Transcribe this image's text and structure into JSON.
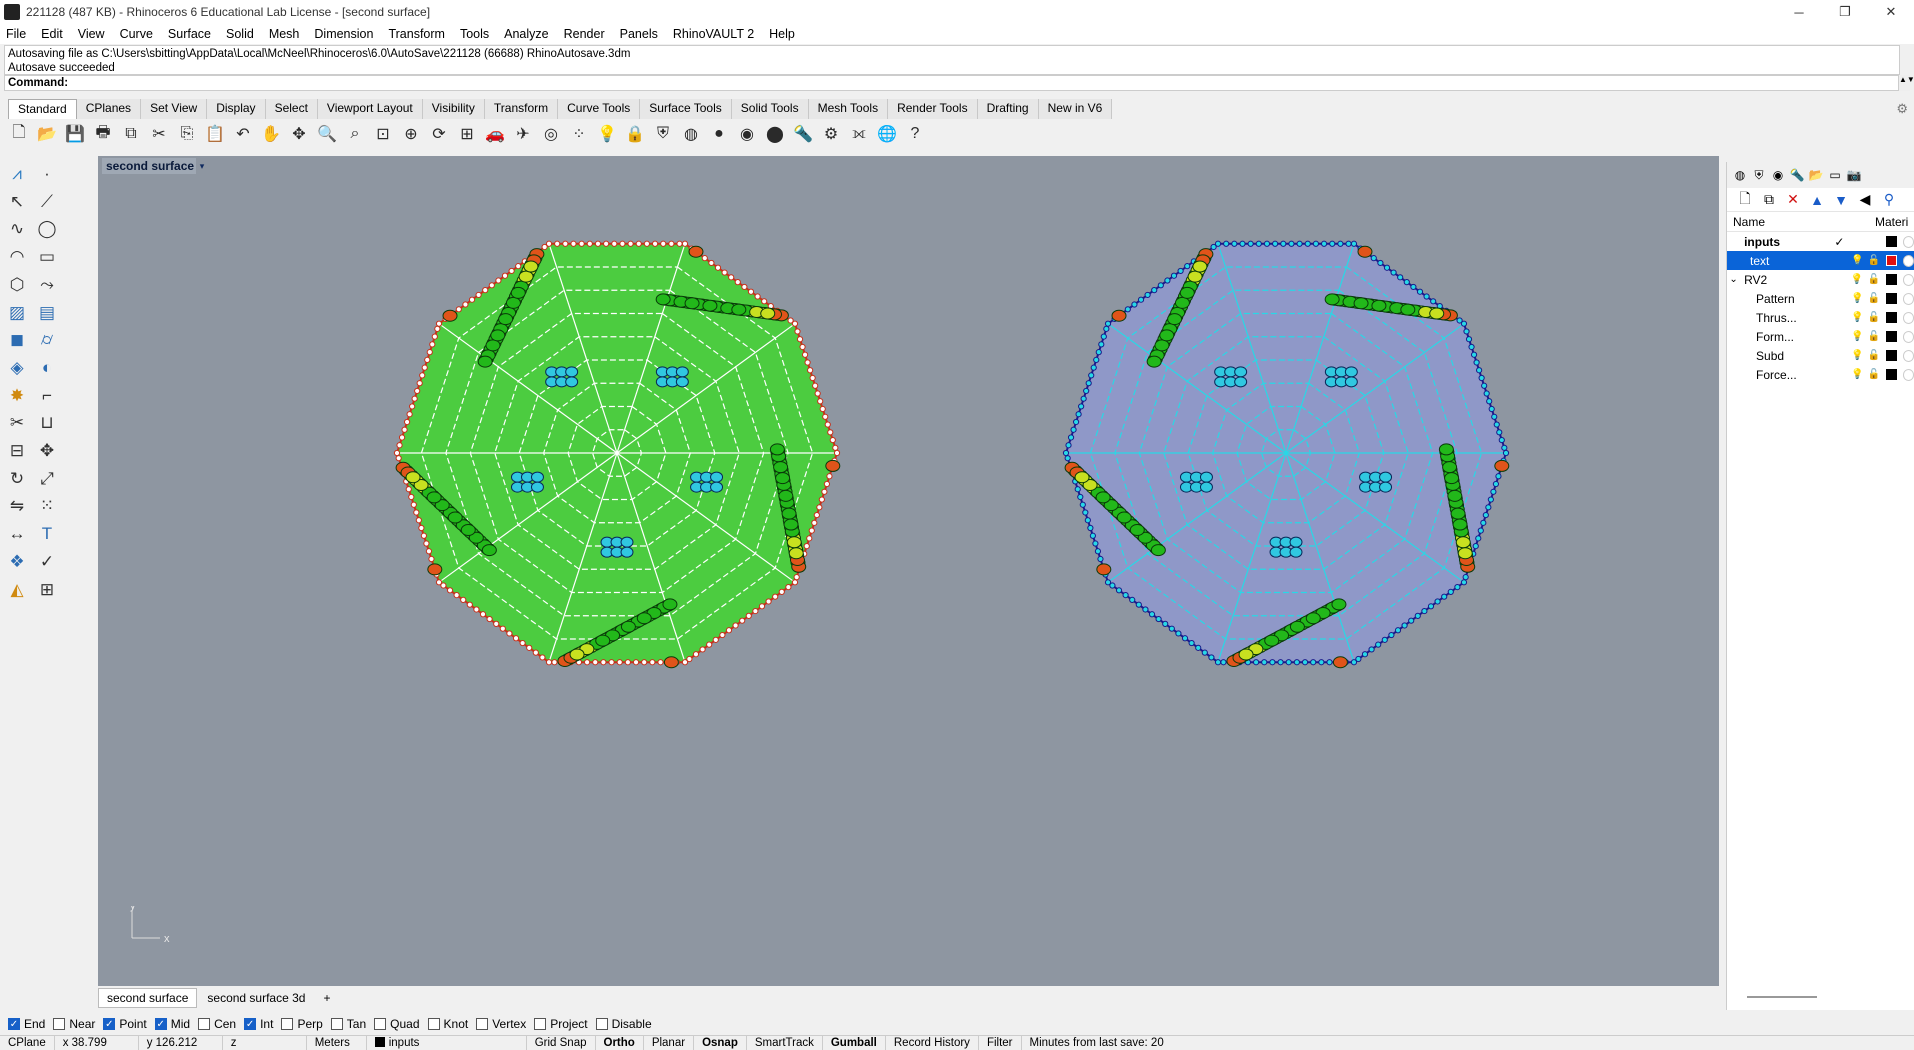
{
  "window": {
    "title": "221128 (487 KB) - Rhinoceros 6 Educational Lab License - [second surface]",
    "controls": [
      "─",
      "❐",
      "✕"
    ]
  },
  "menu": [
    "File",
    "Edit",
    "View",
    "Curve",
    "Surface",
    "Solid",
    "Mesh",
    "Dimension",
    "Transform",
    "Tools",
    "Analyze",
    "Render",
    "Panels",
    "RhinoVAULT 2",
    "Help"
  ],
  "command_history": {
    "line1": "Autosaving file as C:\\Users\\sbitting\\AppData\\Local\\McNeel\\Rhinoceros\\6.0\\AutoSave\\221128 (66688) RhinoAutosave.3dm",
    "line2": "Autosave succeeded"
  },
  "command_prompt": "Command:",
  "toolbar_tabs": [
    "Standard",
    "CPlanes",
    "Set View",
    "Display",
    "Select",
    "Viewport Layout",
    "Visibility",
    "Transform",
    "Curve Tools",
    "Surface Tools",
    "Solid Tools",
    "Mesh Tools",
    "Render Tools",
    "Drafting",
    "New in V6"
  ],
  "toolbar_icons": [
    {
      "name": "new-file-icon",
      "glyph": "🗋"
    },
    {
      "name": "open-file-icon",
      "glyph": "📂"
    },
    {
      "name": "save-icon",
      "glyph": "💾"
    },
    {
      "name": "print-icon",
      "glyph": "🖶"
    },
    {
      "name": "import-icon",
      "glyph": "⧉"
    },
    {
      "name": "cut-icon",
      "glyph": "✂"
    },
    {
      "name": "copy-icon",
      "glyph": "⎘"
    },
    {
      "name": "paste-icon",
      "glyph": "📋"
    },
    {
      "name": "undo-icon",
      "glyph": "↶"
    },
    {
      "name": "pan-hand-icon",
      "glyph": "✋"
    },
    {
      "name": "move-view-icon",
      "glyph": "✥"
    },
    {
      "name": "zoom-icon",
      "glyph": "🔍"
    },
    {
      "name": "zoom-window-icon",
      "glyph": "⌕"
    },
    {
      "name": "zoom-extents-icon",
      "glyph": "⊡"
    },
    {
      "name": "zoom-selected-icon",
      "glyph": "⊕"
    },
    {
      "name": "rotate-view-icon",
      "glyph": "⟳"
    },
    {
      "name": "viewport-grid-icon",
      "glyph": "⊞"
    },
    {
      "name": "car-render-icon",
      "glyph": "🚗"
    },
    {
      "name": "plane-icon",
      "glyph": "✈"
    },
    {
      "name": "select-filter-icon",
      "glyph": "◎"
    },
    {
      "name": "point-icon",
      "glyph": "⁘"
    },
    {
      "name": "light-bulb-icon",
      "glyph": "💡"
    },
    {
      "name": "lock-icon",
      "glyph": "🔒"
    },
    {
      "name": "material-icon",
      "glyph": "⛨"
    },
    {
      "name": "color-wheel-icon",
      "glyph": "◍"
    },
    {
      "name": "sphere-icon",
      "glyph": "●"
    },
    {
      "name": "render-sphere-icon",
      "glyph": "◉"
    },
    {
      "name": "blue-sphere-icon",
      "glyph": "⬤"
    },
    {
      "name": "flashlight-icon",
      "glyph": "🔦"
    },
    {
      "name": "settings-icon",
      "glyph": "⚙"
    },
    {
      "name": "sizing-icon",
      "glyph": "⟗"
    },
    {
      "name": "globe-icon",
      "glyph": "🌐"
    },
    {
      "name": "help-icon",
      "glyph": "?"
    }
  ],
  "left_tools": [
    {
      "name": "rhinovault-icon",
      "glyph": "⩘",
      "color": "#2c7cc2"
    },
    {
      "name": "point-tool-icon",
      "glyph": "·",
      "color": "#333333"
    },
    {
      "name": "select-arrow-icon",
      "glyph": "↖",
      "color": "#333333"
    },
    {
      "name": "polyline-icon",
      "glyph": "⟋",
      "color": "#333333"
    },
    {
      "name": "curve-icon",
      "glyph": "∿",
      "color": "#333333"
    },
    {
      "name": "circle-icon",
      "glyph": "◯",
      "color": "#333333"
    },
    {
      "name": "arc-icon",
      "glyph": "◠",
      "color": "#333333"
    },
    {
      "name": "rectangle-icon",
      "glyph": "▭",
      "color": "#333333"
    },
    {
      "name": "polygon-icon",
      "glyph": "⬡",
      "color": "#333333"
    },
    {
      "name": "freeform-icon",
      "glyph": "⤳",
      "color": "#333333"
    },
    {
      "name": "surface-icon",
      "glyph": "▨",
      "color": "#2c6cb2"
    },
    {
      "name": "extrude-icon",
      "glyph": "▤",
      "color": "#2c6cb2"
    },
    {
      "name": "box-icon",
      "glyph": "◼",
      "color": "#2c6cb2"
    },
    {
      "name": "cylinder-icon",
      "glyph": "⌭",
      "color": "#2c6cb2"
    },
    {
      "name": "mesh-icon",
      "glyph": "◈",
      "color": "#2c6cb2"
    },
    {
      "name": "boolean-icon",
      "glyph": "◐",
      "color": "#2c6cb2"
    },
    {
      "name": "explode-icon",
      "glyph": "✸",
      "color": "#d08a10"
    },
    {
      "name": "fillet-icon",
      "glyph": "⌐",
      "color": "#333333"
    },
    {
      "name": "trim-icon",
      "glyph": "✂",
      "color": "#333333"
    },
    {
      "name": "join-icon",
      "glyph": "⊔",
      "color": "#333333"
    },
    {
      "name": "group-icon",
      "glyph": "⊟",
      "color": "#333333"
    },
    {
      "name": "move-icon",
      "glyph": "✥",
      "color": "#333333"
    },
    {
      "name": "rotate-icon",
      "glyph": "↻",
      "color": "#333333"
    },
    {
      "name": "scale-icon",
      "glyph": "⤢",
      "color": "#333333"
    },
    {
      "name": "mirror-icon",
      "glyph": "⇋",
      "color": "#333333"
    },
    {
      "name": "array-icon",
      "glyph": "⁙",
      "color": "#333333"
    },
    {
      "name": "dimension-icon",
      "glyph": "↔",
      "color": "#333333"
    },
    {
      "name": "text-tool-icon",
      "glyph": "T",
      "color": "#2c6cb2"
    },
    {
      "name": "block-icon",
      "glyph": "❖",
      "color": "#2c6cb2"
    },
    {
      "name": "analyze-icon",
      "glyph": "✓",
      "color": "#333333"
    },
    {
      "name": "render-tool-icon",
      "glyph": "◭",
      "color": "#d08a10"
    },
    {
      "name": "grid-tool-icon",
      "glyph": "⊞",
      "color": "#333333"
    }
  ],
  "viewport": {
    "title": "second surface",
    "dropdown": "▾",
    "axis_y": "y",
    "axis_x": "x",
    "bg_color": "#8e96a1"
  },
  "viewport_tabs": [
    "second surface",
    "second surface 3d",
    "+"
  ],
  "layers_panel": {
    "tab_icons": [
      "◍",
      "⛨",
      "◉",
      "🔦",
      "📂",
      "▭",
      "📷"
    ],
    "tool_icons": [
      "🗋",
      "⧉",
      "✕",
      "▲",
      "▼",
      "◀",
      "⚲"
    ],
    "header_name": "Name",
    "header_material": "Materi",
    "rows": [
      {
        "name": "inputs",
        "indent": 0,
        "bold": true,
        "current": "✓",
        "color": "#000000",
        "selected": false
      },
      {
        "name": "text",
        "indent": 1,
        "bold": false,
        "current": "",
        "color": "#e01010",
        "selected": true
      },
      {
        "name": "RV2",
        "indent": 0,
        "bold": false,
        "current": "",
        "color": "#000000",
        "selected": false,
        "expander": "⌄"
      },
      {
        "name": "Pattern",
        "indent": 2,
        "bold": false,
        "current": "",
        "color": "#000000",
        "selected": false
      },
      {
        "name": "Thrus...",
        "indent": 2,
        "bold": false,
        "current": "",
        "color": "#000000",
        "selected": false
      },
      {
        "name": "Form...",
        "indent": 2,
        "bold": false,
        "current": "",
        "color": "#000000",
        "selected": false
      },
      {
        "name": "Subd",
        "indent": 2,
        "bold": false,
        "current": "",
        "color": "#000000",
        "selected": false
      },
      {
        "name": "Force...",
        "indent": 2,
        "bold": false,
        "current": "",
        "color": "#000000",
        "selected": false
      }
    ]
  },
  "osnaps": [
    {
      "label": "End",
      "checked": true
    },
    {
      "label": "Near",
      "checked": false
    },
    {
      "label": "Point",
      "checked": true
    },
    {
      "label": "Mid",
      "checked": true
    },
    {
      "label": "Cen",
      "checked": false
    },
    {
      "label": "Int",
      "checked": true
    },
    {
      "label": "Perp",
      "checked": false
    },
    {
      "label": "Tan",
      "checked": false
    },
    {
      "label": "Quad",
      "checked": false
    },
    {
      "label": "Knot",
      "checked": false
    },
    {
      "label": "Vertex",
      "checked": false
    },
    {
      "label": "Project",
      "checked": false
    },
    {
      "label": "Disable",
      "checked": false
    }
  ],
  "status": {
    "cplane": "CPlane",
    "x": "x 38.799",
    "y": "y 126.212",
    "z": "z",
    "units": "Meters",
    "layer": "inputs",
    "grid_snap": "Grid Snap",
    "ortho": "Ortho",
    "planar": "Planar",
    "osnap": "Osnap",
    "smarttrack": "SmartTrack",
    "gumball": "Gumball",
    "record_history": "Record History",
    "filter": "Filter",
    "save_info": "Minutes from last save: 20"
  },
  "model": {
    "left_fill": "#4ccc40",
    "right_fill": "#8f98c8",
    "edge_left": "#c8301a",
    "edge_right": "#28d8e6"
  }
}
